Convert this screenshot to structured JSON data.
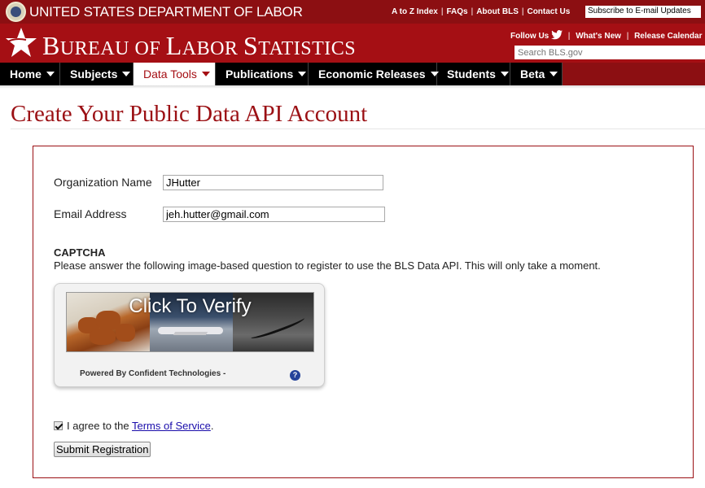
{
  "topbar": {
    "dept_title": "UNITED STATES DEPARTMENT OF LABOR",
    "links": [
      "A to Z Index",
      "FAQs",
      "About BLS",
      "Contact Us"
    ],
    "subscribe_placeholder": "Subscribe to E-mail Updates"
  },
  "header": {
    "title_b": "B",
    "title_ureau": "UREAU OF ",
    "title_l": "L",
    "title_abor": "ABOR ",
    "title_s": "S",
    "title_tatistics": "TATISTICS",
    "follow_us": "Follow Us",
    "whats_new": "What's New",
    "release_calendar": "Release Calendar",
    "search_placeholder": "Search BLS.gov"
  },
  "nav": {
    "items": [
      "Home",
      "Subjects",
      "Data Tools",
      "Publications",
      "Economic Releases",
      "Students",
      "Beta"
    ],
    "active": "Data Tools"
  },
  "page": {
    "title": "Create Your Public Data API Account"
  },
  "form": {
    "org_label": "Organization Name",
    "org_value": "JHutter",
    "email_label": "Email Address",
    "email_value": "jeh.hutter@gmail.com",
    "captcha_heading": "CAPTCHA",
    "captcha_instructions": "Please answer the following image-based question to register to use the BLS Data API. This will only take a moment.",
    "captcha_overlay": "Click To Verify",
    "captcha_powered": "Powered By Confident Technologies   -",
    "captcha_help": "?",
    "agree_text": "I agree to the ",
    "terms_link": "Terms of Service",
    "agree_period": ".",
    "agree_checked": true,
    "submit_label": "Submit Registration"
  },
  "colors": {
    "brand_dark_red": "#8c0f12",
    "brand_red": "#a50f14",
    "title_red": "#9b1014",
    "link_blue": "#1a0dab"
  }
}
